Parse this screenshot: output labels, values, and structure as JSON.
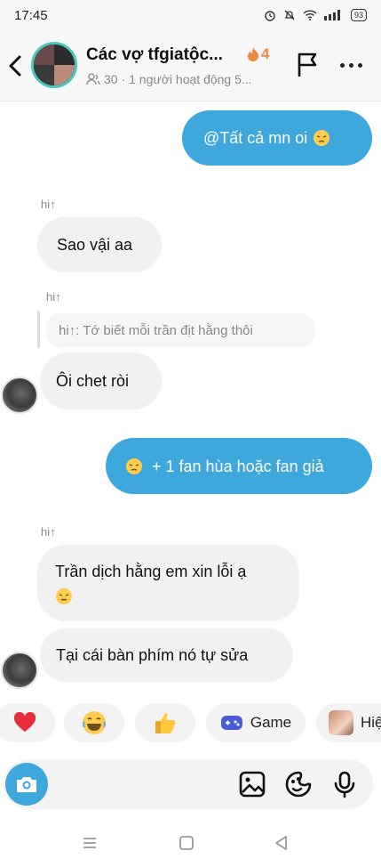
{
  "status_bar": {
    "time": "17:45",
    "battery": "93"
  },
  "header": {
    "title": "Các vợ tfgiatộc...",
    "streak_count": "4",
    "member_count": "30",
    "activity": "· 1 người hoạt động 5..."
  },
  "messages": [
    {
      "direction": "out",
      "text": "@Tất cả  mn oi",
      "emoji": "pensive-face"
    },
    {
      "direction": "in",
      "sender": "hi↑",
      "text": "Sao vậi aa"
    },
    {
      "direction": "in",
      "sender": "hi↑",
      "reply_to": "hi↑: Tớ biết mỗi trần địt hằng thôi",
      "text": "Ôi chet ròi"
    },
    {
      "direction": "out",
      "text": "+ 1 fan hùa hoặc fan giả",
      "emoji": "pensive-face"
    },
    {
      "direction": "in",
      "sender": "hi↑",
      "text": "Trần dịch hằng em xin lỗi ạ",
      "emoji": "pensive-face"
    },
    {
      "direction": "in",
      "text": "Tại cái bàn phím nó tự sửa"
    }
  ],
  "quick_reactions": [
    {
      "icon": "red-heart-icon"
    },
    {
      "icon": "laughing-face-icon"
    },
    {
      "icon": "thumbs-up-icon"
    },
    {
      "icon": "gamepad-icon",
      "label": "Game"
    },
    {
      "icon": "avatar-thumb",
      "label": "Hiệ"
    }
  ],
  "composer": {
    "placeholder": ""
  },
  "colors": {
    "outgoing_bubble": "#3ea7dc",
    "incoming_bubble": "#f1f1f1",
    "avatar_ring": "#4cc6c0",
    "streak": "#f0883e"
  }
}
